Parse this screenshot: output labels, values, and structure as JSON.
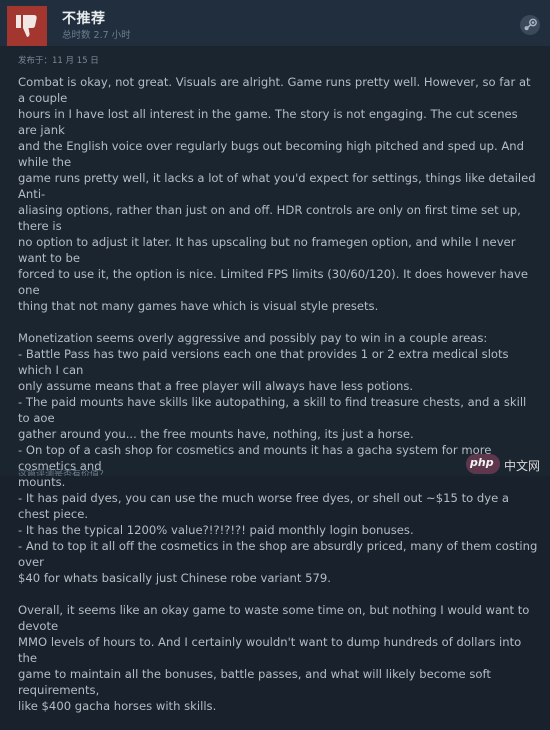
{
  "review": {
    "verdict": "不推荐",
    "hours": "总时数 2.7 小时",
    "posted": "发布于：11 月 15 日",
    "paragraphs": [
      [
        "Combat is okay, not great. Visuals are alright. Game runs pretty well. However, so far at a couple",
        "hours in I have lost all interest in the game. The story is not engaging. The cut scenes are jank",
        "and the English voice over regularly bugs out becoming high pitched and sped up. And while the",
        "game runs pretty well, it lacks a lot of what you'd expect for settings, things like detailed Anti-",
        "aliasing options, rather than just on and off. HDR controls are only on first time set up, there is",
        "no option to adjust it later. It has upscaling but no framegen option, and while I never want to be",
        "forced to use it, the option is nice. Limited FPS limits (30/60/120). It does however have one",
        "thing that not many games have which is visual style presets."
      ],
      [
        "Monetization seems overly aggressive and possibly pay to win in a couple areas:",
        "- Battle Pass has two paid versions each one that provides 1 or 2 extra medical slots which I can",
        "only assume means that a free player will always have less potions.",
        "- The paid mounts have skills like autopathing, a skill to find treasure chests, and a skill to aoe",
        "gather around you... the free mounts have, nothing, its just a horse.",
        "- On top of a cash shop for cosmetics and mounts it has a gacha system for more cosmetics and",
        "mounts.",
        "- It has paid dyes, you can use the much worse free dyes, or shell out ~$15 to dye a chest piece.",
        "- It has the typical 1200% value?!?!?!?! paid monthly login bonuses.",
        "- And to top it all off the cosmetics in the shop are absurdly priced, many of them costing over",
        "$40 for whats basically just Chinese robe variant 579."
      ],
      [
        "Overall, it seems like an okay game to waste some time on, but nothing I would want to devote",
        "MMO levels of hours to. And I certainly wouldn't want to dump hundreds of dollars into the",
        "game to maintain all the bonuses, battle passes, and what will likely become soft requirements,",
        "like $400 gacha horses with skills."
      ]
    ],
    "footer_partial": "这篇评测是否有价值？"
  },
  "watermark": {
    "logo": "php",
    "site": "中文网"
  },
  "colors": {
    "header_bg": "#202e3d",
    "thumb_bg": "#a3362f",
    "body_bg": "#1b2530",
    "text": "#b4bcc4"
  },
  "icons": {
    "verdict": "thumbs-down-icon",
    "platform": "steam-icon"
  }
}
